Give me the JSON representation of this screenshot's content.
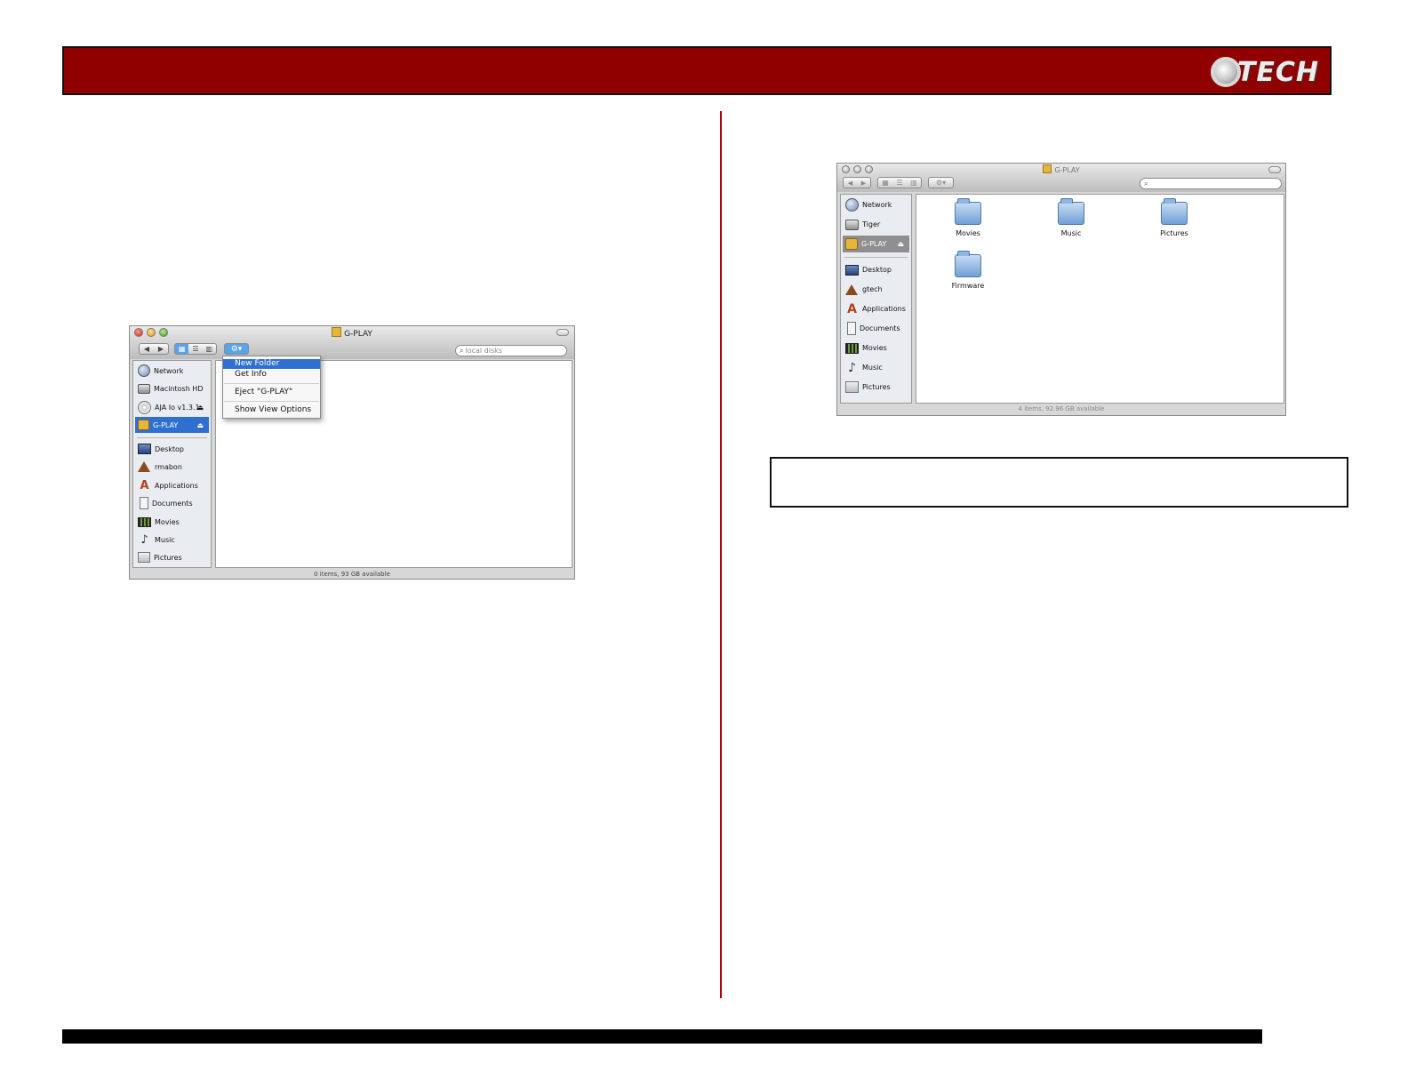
{
  "brand": {
    "logo_text": "TECH"
  },
  "left_window": {
    "title": "G-PLAY",
    "search_placeholder": "local disks",
    "sidebar": [
      {
        "label": "Network",
        "icon": "globe-icon"
      },
      {
        "label": "Macintosh HD",
        "icon": "hard-drive-icon"
      },
      {
        "label": "AJA Io v1.3.1",
        "icon": "cd-disc-icon",
        "eject": "⏏"
      },
      {
        "label": "G-PLAY",
        "icon": "external-drive-icon",
        "eject": "⏏",
        "selected": true
      },
      {
        "label": "Desktop",
        "icon": "desktop-icon"
      },
      {
        "label": "rmabon",
        "icon": "home-icon"
      },
      {
        "label": "Applications",
        "icon": "applications-icon"
      },
      {
        "label": "Documents",
        "icon": "documents-icon"
      },
      {
        "label": "Movies",
        "icon": "movies-icon"
      },
      {
        "label": "Music",
        "icon": "music-icon"
      },
      {
        "label": "Pictures",
        "icon": "pictures-icon"
      }
    ],
    "action_menu": [
      "New Folder",
      "Get Info",
      "Eject \"G-PLAY\"",
      "Show View Options"
    ],
    "status": "0 items, 93 GB available"
  },
  "right_window": {
    "title": "G-PLAY",
    "sidebar": [
      {
        "label": "Network",
        "icon": "globe-icon"
      },
      {
        "label": "Tiger",
        "icon": "hard-drive-icon"
      },
      {
        "label": "G-PLAY",
        "icon": "external-drive-icon",
        "eject": "⏏",
        "selected": true
      },
      {
        "label": "Desktop",
        "icon": "desktop-icon"
      },
      {
        "label": "gtech",
        "icon": "home-icon"
      },
      {
        "label": "Applications",
        "icon": "applications-icon"
      },
      {
        "label": "Documents",
        "icon": "documents-icon"
      },
      {
        "label": "Movies",
        "icon": "movies-icon"
      },
      {
        "label": "Music",
        "icon": "music-icon"
      },
      {
        "label": "Pictures",
        "icon": "pictures-icon"
      }
    ],
    "folders": [
      "Movies",
      "Music",
      "Pictures",
      "Firmware"
    ],
    "status": "4 items, 92.96 GB available"
  },
  "colors": {
    "header": "#900000",
    "divider": "#b00000",
    "selection": "#2f6fd0"
  }
}
